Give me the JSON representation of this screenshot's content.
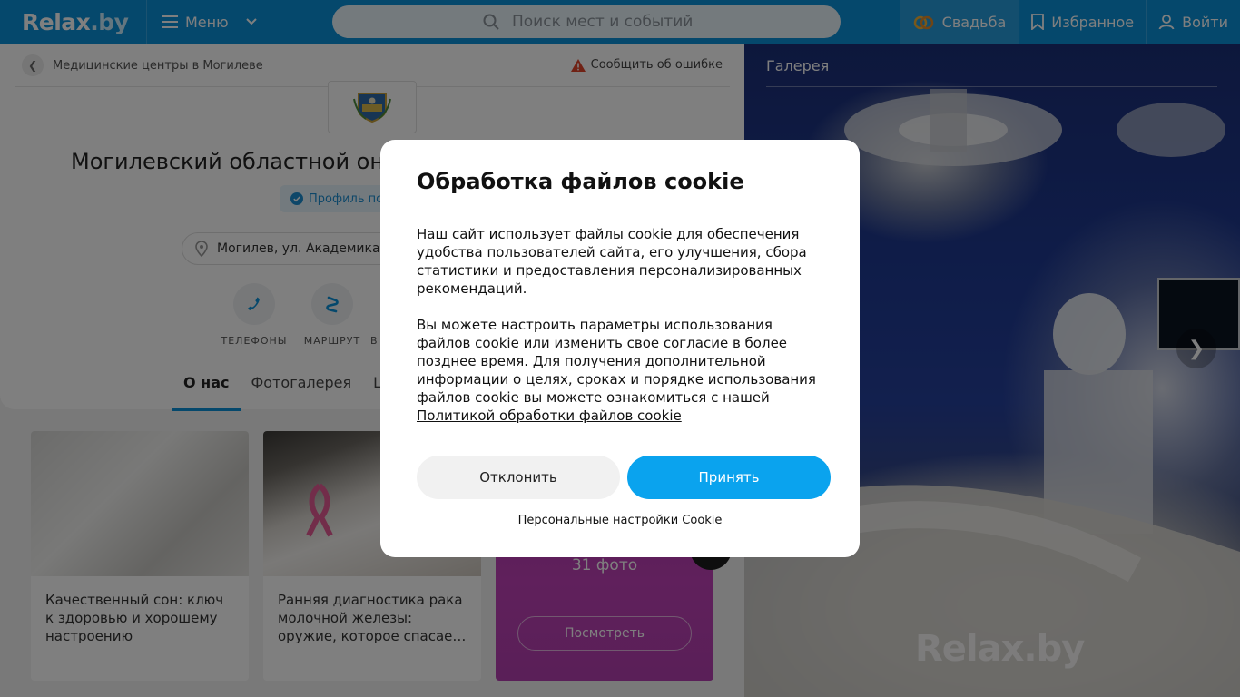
{
  "header": {
    "logo": "Relax",
    "logo_suffix": ".by",
    "menu_label": "Меню",
    "search_placeholder": "Поиск мест и событий",
    "wedding_label": "Свадьба",
    "favorites_label": "Избранное",
    "login_label": "Войти"
  },
  "page": {
    "breadcrumb": "Медицинские центры в Могилеве",
    "report_label": "Сообщить об ошибке",
    "title": "Могилевский областной он",
    "verified_label": "Профиль по",
    "address": "Могилев, ул. Академика",
    "actions": [
      {
        "label": "ТЕЛЕФОНЫ",
        "icon": "phone-icon"
      },
      {
        "label": "МАРШРУТ",
        "icon": "route-icon"
      },
      {
        "label": "В",
        "icon": "more-icon"
      }
    ],
    "tabs": [
      "О нас",
      "Фотогалерея",
      "Це"
    ]
  },
  "articles": [
    {
      "title": "Качественный сон: ключ к здоровью и хорошему настроению"
    },
    {
      "title": "Ранняя диагностика рака молочной железы: оружие, которое спасае…"
    }
  ],
  "gallery_promo": {
    "count": "31 фото",
    "button": "Посмотреть"
  },
  "gallery": {
    "title": "Галерея",
    "watermark": "Relax.by"
  },
  "cookie": {
    "title": "Обработка файлов cookie",
    "paragraph1": "Наш сайт использует файлы cookie для обеспечения удобства пользователей сайта, его улучшения, сбора статистики и предоставления персонализированных рекомендаций.",
    "paragraph2": "Вы можете настроить параметры использования файлов cookie или изменить свое согласие в более позднее время. Для получения дополнительной информации о целях, сроках и порядке использования файлов cookie вы можете ознакомиться с нашей",
    "policy_link": "Политикой обработки файлов cookie",
    "decline": "Отклонить",
    "accept": "Принять",
    "personal_settings": "Персональные настройки Cookie"
  },
  "colors": {
    "brand": "#0a90d9",
    "accept": "#0aa3ee",
    "promo": "#b43fb0"
  }
}
